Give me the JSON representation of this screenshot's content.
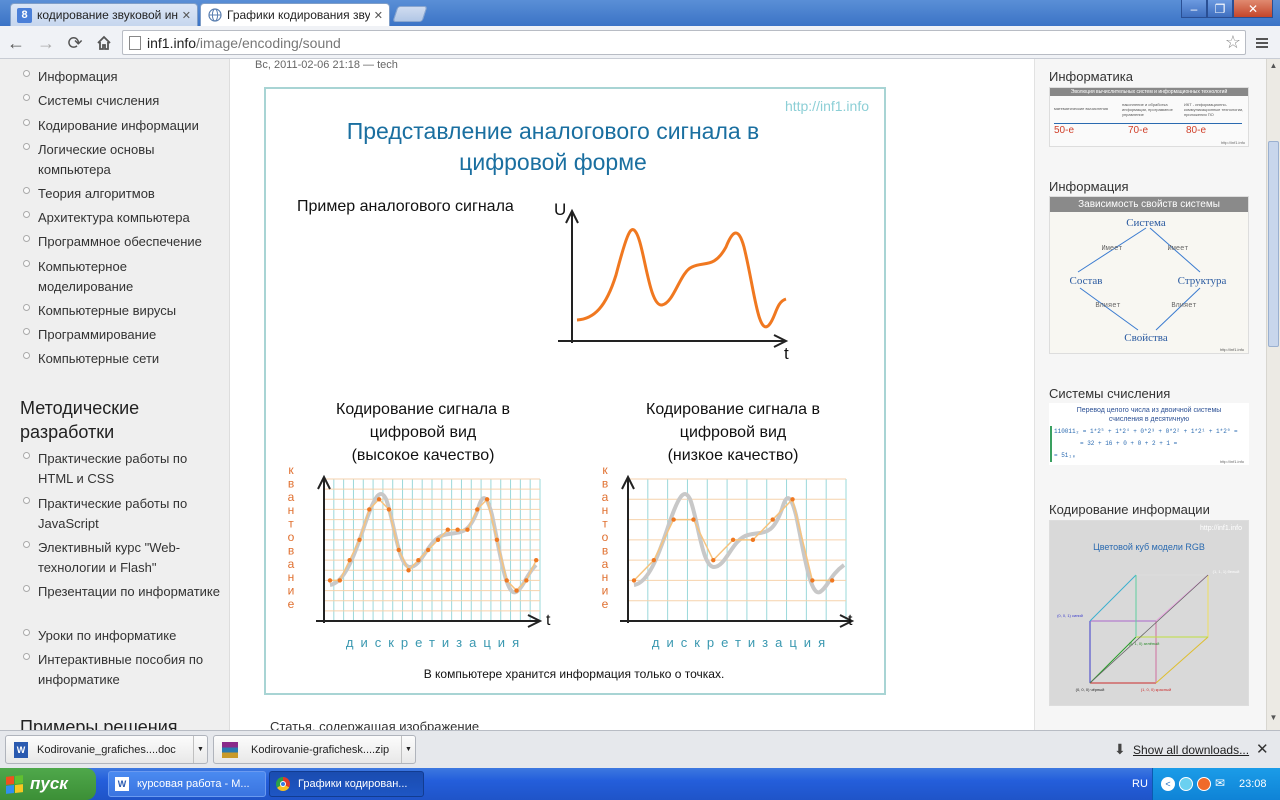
{
  "tabs": [
    {
      "label": "кодирование звуковой инф",
      "icon": "google-icon",
      "active": false
    },
    {
      "label": "Графики кодирования звук",
      "icon": "globe-icon",
      "active": true
    }
  ],
  "window_controls": {
    "minimize": "‒",
    "maximize": "❐",
    "close": "✕"
  },
  "address": {
    "host": "inf1.info",
    "path": "/image/encoding/sound"
  },
  "left_nav": {
    "items": [
      "Информация",
      "Системы счисления",
      "Кодирование информации",
      "Логические основы компьютера",
      "Теория алгоритмов",
      "Архитектура компьютера",
      "Программное обеспечение",
      "Компьютерное моделирование",
      "Компьютерные вирусы",
      "Программирование",
      "Компьютерные сети"
    ],
    "methods_heading": "Методические разработки",
    "methods_items": [
      "Практические работы по HTML и CSS",
      "Практические работы по JavaScript",
      "Элективный курс \"Web-технологии и Flash\"",
      "Презентации по информатике",
      "Уроки по информатике",
      "Интерактивные пособия по информатике"
    ],
    "next_heading": "Примеры решения"
  },
  "article": {
    "meta": "Вс, 2011-02-06 21:18 — tech",
    "caption": "Статья, содержащая изображение"
  },
  "figure": {
    "site": "http://inf1.info",
    "title_line1": "Представление аналогового сигнала в",
    "title_line2": "цифровой форме",
    "example_label": "Пример аналогового сигнала",
    "u_label": "U",
    "t_label": "t",
    "left_title": [
      "Кодирование сигнала в",
      "цифровой вид",
      "(высокое качество)"
    ],
    "right_title": [
      "Кодирование сигнала в",
      "цифровой вид",
      "(низкое качество)"
    ],
    "kvant": "квантование",
    "discr": "дискретизация",
    "footer": "В компьютере хранится информация только о точках."
  },
  "sidebar": {
    "blocks": [
      {
        "title": "Информатика",
        "header": "Эволюция вычислительных систем и информационных технологий",
        "cols": [
          "математические вычисления",
          "накопление и обработка информации, программное управление",
          "ИКТ - информационно-коммуникационные технологии, приложения ПО"
        ],
        "marks": [
          "50-е",
          "70-е",
          "80-е"
        ],
        "url": "http://inf1.info"
      },
      {
        "title": "Информация",
        "header": "Зависимость свойств системы",
        "nodes": [
          "Система",
          "Состав",
          "Структура",
          "Свойства"
        ],
        "edges": [
          "Имеет",
          "Имеет",
          "Влияет",
          "Влияет"
        ],
        "url": "http://inf1.info"
      },
      {
        "title": "Системы счисления",
        "header": "Перевод целого числа из двоичной системы счисления в десятичную",
        "line1": "110011₂ = 1*2⁵ + 1*2⁴ + 0*2³ + 0*2² + 1*2¹ + 1*2⁰ =",
        "line2": "= 32 + 16 + 0 + 0 + 2 + 1 =",
        "line3": "= 51₁₀",
        "url": "http://inf1.info"
      },
      {
        "title": "Кодирование информации",
        "header": "Цветовой куб модели RGB",
        "url": "http://inf1.info",
        "labels": [
          "(0, 0, 0) чёрный",
          "(1, 0, 0) красный",
          "(0, 1, 0) зелёный",
          "(0, 0, 1) синий",
          "(1, 1, 1) белый"
        ]
      }
    ]
  },
  "downloads": {
    "items": [
      {
        "name": "Kodirovanie_grafiches....doc",
        "icon": "word-doc-icon"
      },
      {
        "name": "Kodirovanie-grafichesk....zip",
        "icon": "winrar-archive-icon"
      }
    ],
    "show_all": "Show all downloads..."
  },
  "taskbar": {
    "start": "пуск",
    "tasks": [
      {
        "label": "курсовая работа - M...",
        "icon": "word-icon"
      },
      {
        "label": "Графики кодирован...",
        "icon": "chrome-icon"
      }
    ],
    "lang": "RU",
    "time": "23:08"
  },
  "colors": {
    "accent_title": "#1a6fa0",
    "signal": "#f07820",
    "axis_label": "#e07030",
    "discr_label": "#3a98b0",
    "grid_teal": "#7ecfd0",
    "grid_orange": "#f4c89a",
    "border_teal": "#a8d4d4"
  }
}
